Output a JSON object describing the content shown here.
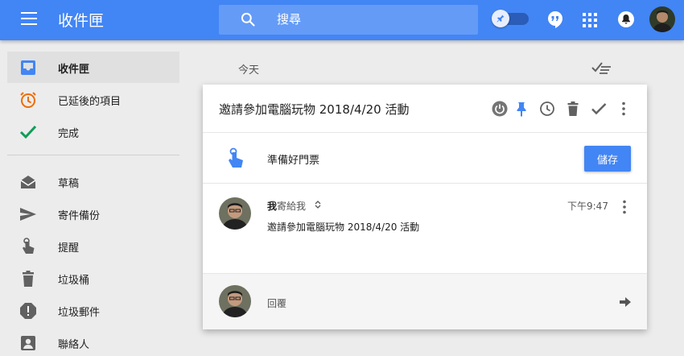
{
  "app": {
    "title": "收件匣"
  },
  "search": {
    "placeholder": "搜尋"
  },
  "sidebar": {
    "items": [
      {
        "label": "收件匣",
        "icon": "inbox-icon",
        "color": "#4285f4",
        "active": true
      },
      {
        "label": "已延後的項目",
        "icon": "snooze-clock-icon",
        "color": "#ef6c00"
      },
      {
        "label": "完成",
        "icon": "check-icon",
        "color": "#0f9d58"
      },
      {
        "label": "草稿",
        "icon": "drafts-envelope-icon",
        "color": "#616161"
      },
      {
        "label": "寄件備份",
        "icon": "send-icon",
        "color": "#616161"
      },
      {
        "label": "提醒",
        "icon": "reminder-finger-icon",
        "color": "#616161"
      },
      {
        "label": "垃圾桶",
        "icon": "trash-icon",
        "color": "#616161"
      },
      {
        "label": "垃圾郵件",
        "icon": "spam-icon",
        "color": "#616161"
      },
      {
        "label": "聯絡人",
        "icon": "contacts-icon",
        "color": "#616161"
      }
    ]
  },
  "section": {
    "label": "今天"
  },
  "card": {
    "subject": "邀請參加電腦玩物 2018/4/20 活動",
    "reminder": {
      "text": "準備好門票",
      "save_label": "儲存"
    },
    "message": {
      "sender": "我",
      "recipient": "寄給我",
      "time": "下午9:47",
      "body": "邀請參加電腦玩物 2018/4/20 活動"
    },
    "reply_label": "回覆"
  },
  "colors": {
    "accent": "#4285f4",
    "background": "#ececec",
    "card": "#ffffff"
  }
}
